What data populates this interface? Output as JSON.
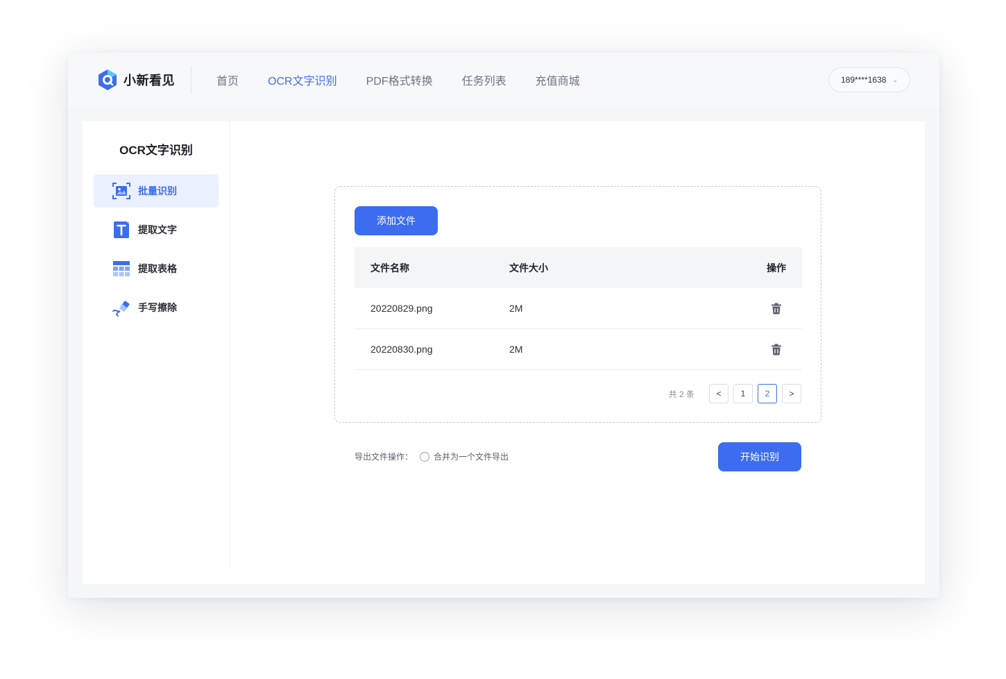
{
  "app": {
    "name": "小新看见",
    "brand_color": "#3c6df0"
  },
  "nav": {
    "items": [
      {
        "label": "首页",
        "active": false
      },
      {
        "label": "OCR文字识别",
        "active": true
      },
      {
        "label": "PDF格式转换",
        "active": false
      },
      {
        "label": "任务列表",
        "active": false
      },
      {
        "label": "充值商城",
        "active": false
      }
    ]
  },
  "user": {
    "phone": "189****1638",
    "dropdown_icon": "chevron-down-icon"
  },
  "sidebar": {
    "title": "OCR文字识别",
    "items": [
      {
        "label": "批量识别",
        "icon": "batch-image-icon",
        "active": true
      },
      {
        "label": "提取文字",
        "icon": "text-t-icon",
        "active": false
      },
      {
        "label": "提取表格",
        "icon": "table-grid-icon",
        "active": false
      },
      {
        "label": "手写擦除",
        "icon": "eraser-icon",
        "active": false
      }
    ]
  },
  "upload": {
    "add_button": "添加文件",
    "columns": {
      "name": "文件名称",
      "size": "文件大小",
      "action": "操作"
    },
    "rows": [
      {
        "name": "20220829.png",
        "size": "2M",
        "action_icon": "trash-icon"
      },
      {
        "name": "20220830.png",
        "size": "2M",
        "action_icon": "trash-icon"
      }
    ],
    "pagination": {
      "total_text": "共 2 条",
      "prev": "<",
      "pages": [
        "1",
        "2"
      ],
      "current": "2",
      "next": ">"
    }
  },
  "export": {
    "label": "导出文件操作：",
    "option": "合并为一个文件导出",
    "checked": false
  },
  "start_button": "开始识别"
}
